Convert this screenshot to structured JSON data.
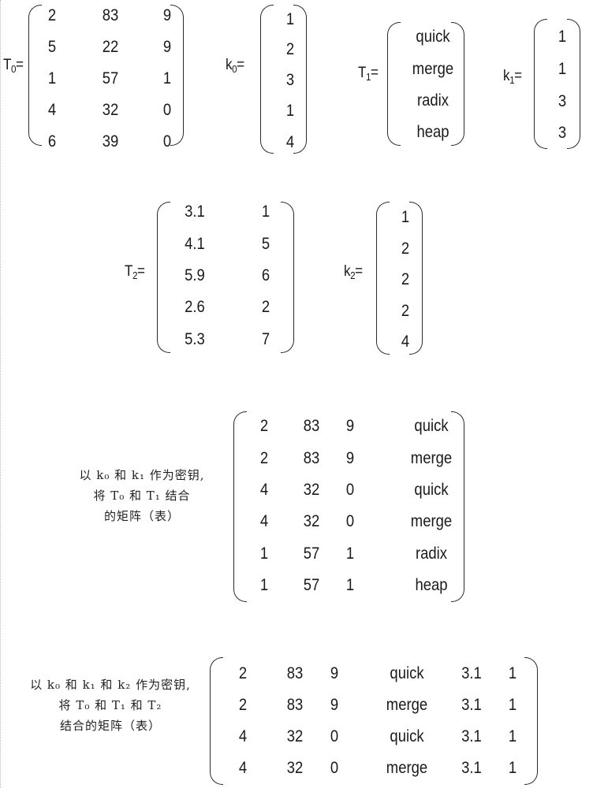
{
  "matrices": {
    "T0": {
      "label": "T",
      "sub": "0",
      "rows": [
        [
          "2",
          "83",
          "9"
        ],
        [
          "5",
          "22",
          "9"
        ],
        [
          "1",
          "57",
          "1"
        ],
        [
          "4",
          "32",
          "0"
        ],
        [
          "6",
          "39",
          "0"
        ]
      ]
    },
    "k0": {
      "label": "k",
      "sub": "0",
      "rows": [
        [
          "1"
        ],
        [
          "2"
        ],
        [
          "3"
        ],
        [
          "1"
        ],
        [
          "4"
        ]
      ]
    },
    "T1": {
      "label": "T",
      "sub": "1",
      "rows": [
        [
          "quick"
        ],
        [
          "merge"
        ],
        [
          "radix"
        ],
        [
          "heap"
        ]
      ]
    },
    "k1": {
      "label": "k",
      "sub": "1",
      "rows": [
        [
          "1"
        ],
        [
          "1"
        ],
        [
          "3"
        ],
        [
          "3"
        ]
      ]
    },
    "T2": {
      "label": "T",
      "sub": "2",
      "rows": [
        [
          "3.1",
          "1"
        ],
        [
          "4.1",
          "5"
        ],
        [
          "5.9",
          "6"
        ],
        [
          "2.6",
          "2"
        ],
        [
          "5.3",
          "7"
        ]
      ]
    },
    "k2": {
      "label": "k",
      "sub": "2",
      "rows": [
        [
          "1"
        ],
        [
          "2"
        ],
        [
          "2"
        ],
        [
          "2"
        ],
        [
          "4"
        ]
      ]
    },
    "J01": {
      "caption_lines": [
        "以 k₀ 和 k₁ 作为密钥,",
        "将 T₀ 和 T₁ 结合",
        "的矩阵（表）"
      ],
      "rows": [
        [
          "2",
          "83",
          "9",
          "quick"
        ],
        [
          "2",
          "83",
          "9",
          "merge"
        ],
        [
          "4",
          "32",
          "0",
          "quick"
        ],
        [
          "4",
          "32",
          "0",
          "merge"
        ],
        [
          "1",
          "57",
          "1",
          "radix"
        ],
        [
          "1",
          "57",
          "1",
          "heap"
        ]
      ]
    },
    "J012": {
      "caption_lines": [
        "以 k₀ 和 k₁ 和 k₂ 作为密钥,",
        "将 T₀ 和 T₁ 和 T₂",
        "结合的矩阵（表）"
      ],
      "rows": [
        [
          "2",
          "83",
          "9",
          "quick",
          "3.1",
          "1"
        ],
        [
          "2",
          "83",
          "9",
          "merge",
          "3.1",
          "1"
        ],
        [
          "4",
          "32",
          "0",
          "quick",
          "3.1",
          "1"
        ],
        [
          "4",
          "32",
          "0",
          "merge",
          "3.1",
          "1"
        ]
      ]
    }
  },
  "equals_sign": "="
}
